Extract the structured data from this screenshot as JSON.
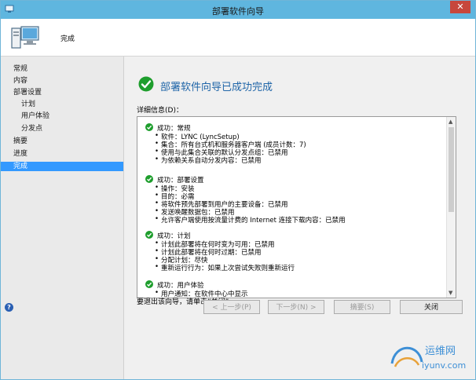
{
  "window": {
    "title": "部署软件向导",
    "close_label": "✕"
  },
  "header": {
    "title": "完成"
  },
  "nav": {
    "items": [
      {
        "label": "常规",
        "indent": false,
        "active": false
      },
      {
        "label": "内容",
        "indent": false,
        "active": false
      },
      {
        "label": "部署设置",
        "indent": false,
        "active": false
      },
      {
        "label": "计划",
        "indent": true,
        "active": false
      },
      {
        "label": "用户体验",
        "indent": true,
        "active": false
      },
      {
        "label": "分发点",
        "indent": true,
        "active": false
      },
      {
        "label": "摘要",
        "indent": false,
        "active": false
      },
      {
        "label": "进度",
        "indent": false,
        "active": false
      },
      {
        "label": "完成",
        "indent": false,
        "active": true
      }
    ]
  },
  "main": {
    "success_title": "部署软件向导已成功完成",
    "detail_label": "详细信息(D)：",
    "exit_hint": "要退出该向导，请单击“关闭”。",
    "sections": [
      {
        "head": "成功：常规",
        "items": [
          "软件：LYNC (LyncSetup)",
          "集合：所有台式机和服务器客户端 (成员计数：7)",
          "使用与此集合关联的默认分发点组：已禁用",
          "为依赖关系自动分发内容：已禁用"
        ]
      },
      {
        "head": "成功：部署设置",
        "items": [
          "操作：安装",
          "目的：必需",
          "将软件预先部署到用户的主要设备：已禁用",
          "发送唤醒数据包：已禁用",
          "允许客户端使用按流量计费的 Internet 连接下载内容：已禁用"
        ]
      },
      {
        "head": "成功：计划",
        "items": [
          "计划此部署将在何时变为可用：已禁用",
          "计划此部署将在何时过期：已禁用",
          "分配计划：尽快",
          "重新运行行为：如果上次尝试失败则重新运行"
        ]
      },
      {
        "head": "成功：用户体验",
        "items": [
          "用户通知：在软件中心中显示"
        ]
      }
    ]
  },
  "buttons": {
    "prev": "< 上一步(P)",
    "next": "下一步(N) >",
    "summary": "摘要(S)",
    "close": "关闭"
  },
  "help_label": "?",
  "watermark": {
    "line1": "运维网",
    "line2": "iyunv.com"
  },
  "colors": {
    "titlebar": "#5fb6df",
    "accent": "#3399ff",
    "success": "#1e9e2d",
    "title_blue": "#1f65a8"
  }
}
